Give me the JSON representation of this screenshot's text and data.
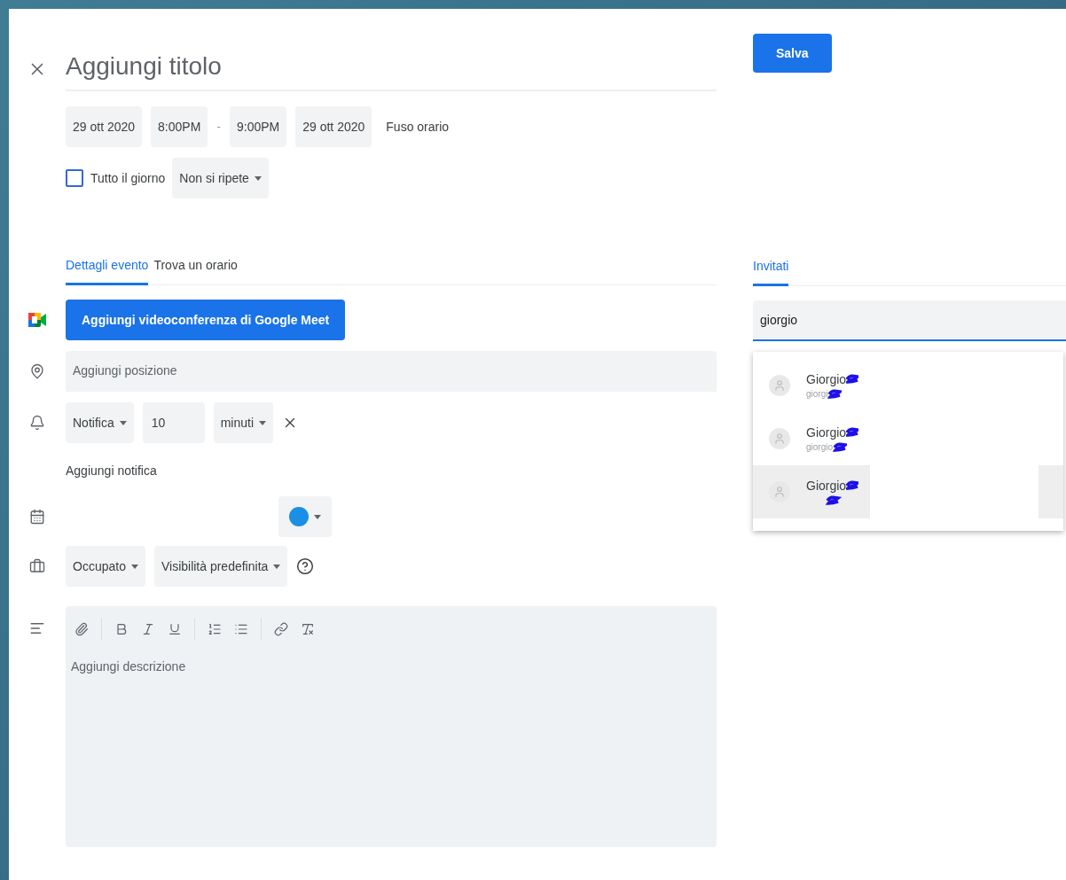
{
  "title_field": {
    "placeholder": "Aggiungi titolo"
  },
  "save_button": "Salva",
  "date_time": {
    "start_date": "29 ott 2020",
    "start_time": "8:00PM",
    "separator": "-",
    "end_time": "9:00PM",
    "end_date": "29 ott 2020",
    "timezone": "Fuso orario"
  },
  "all_day": {
    "label": "Tutto il giorno",
    "checked": false
  },
  "repeat": "Non si ripete",
  "tabs": [
    {
      "label": "Dettagli evento",
      "selected": true
    },
    {
      "label": "Trova un orario",
      "selected": false
    }
  ],
  "meet_button": "Aggiungi videoconferenza di Google Meet",
  "location": {
    "placeholder": "Aggiungi posizione"
  },
  "notification": {
    "type": "Notifica",
    "amount": "10",
    "unit": "minuti"
  },
  "add_notification": "Aggiungi notifica",
  "calendar": {
    "color": "#1a8fe3"
  },
  "availability": "Occupato",
  "visibility": "Visibilità predefinita",
  "description": {
    "placeholder": "Aggiungi descrizione"
  },
  "guests": {
    "tab": {
      "label": "Invitati",
      "selected": true
    },
    "search": {
      "value": "giorgio"
    },
    "suggestions": [
      {
        "name": "Giorgio",
        "email": "giorgi",
        "selected": false
      },
      {
        "name": "Giorgio",
        "email": "giorgio",
        "selected": false
      },
      {
        "name": "Giorgio",
        "selected": true
      }
    ]
  }
}
